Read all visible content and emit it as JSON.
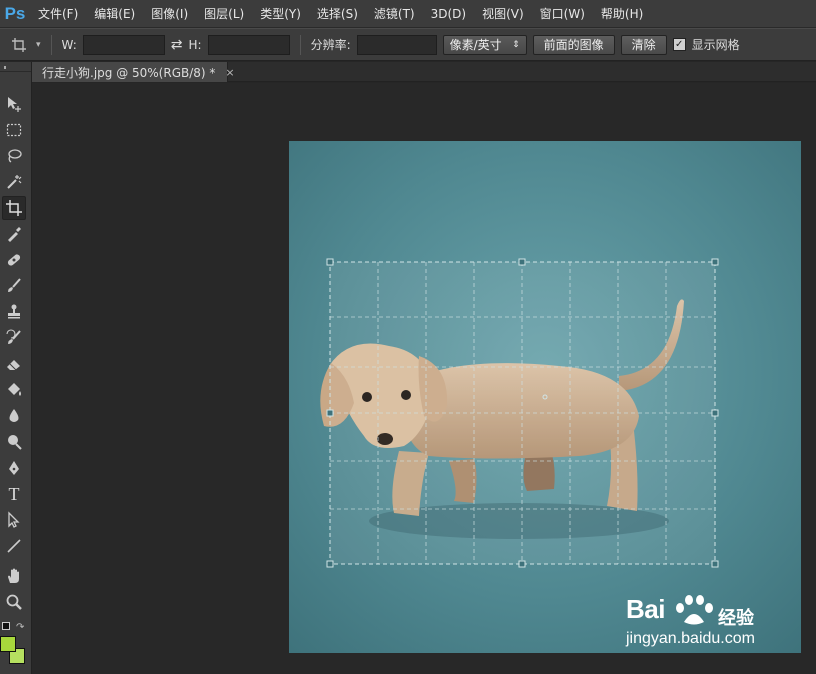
{
  "app": {
    "logo": "Ps"
  },
  "menu": [
    "文件(F)",
    "编辑(E)",
    "图像(I)",
    "图层(L)",
    "类型(Y)",
    "选择(S)",
    "滤镜(T)",
    "3D(D)",
    "视图(V)",
    "窗口(W)",
    "帮助(H)"
  ],
  "options": {
    "w_label": "W:",
    "w_value": "",
    "swap_symbol": "⇄",
    "h_label": "H:",
    "h_value": "",
    "resolution_label": "分辨率:",
    "resolution_value": "",
    "unit_select": "像素/英寸",
    "front_image_button": "前面的图像",
    "clear_button": "清除",
    "show_grid_label": "显示网格",
    "show_grid_checked": true
  },
  "document_tab": {
    "title": "行走小狗.jpg @ 50%(RGB/8) *",
    "close": "×"
  },
  "tools": [
    {
      "name": "move-tool",
      "icon": "move-icon",
      "active": false
    },
    {
      "name": "marquee-tool",
      "icon": "marquee-icon",
      "active": false
    },
    {
      "name": "lasso-tool",
      "icon": "lasso-icon",
      "active": false
    },
    {
      "name": "magic-wand-tool",
      "icon": "magic-wand-icon",
      "active": false
    },
    {
      "name": "crop-tool",
      "icon": "crop-icon",
      "active": true
    },
    {
      "name": "eyedropper-tool",
      "icon": "eyedropper-icon",
      "active": false
    },
    {
      "name": "healing-brush-tool",
      "icon": "bandage-icon",
      "active": false
    },
    {
      "name": "brush-tool",
      "icon": "brush-icon",
      "active": false
    },
    {
      "name": "clone-stamp-tool",
      "icon": "stamp-icon",
      "active": false
    },
    {
      "name": "history-brush-tool",
      "icon": "history-brush-icon",
      "active": false
    },
    {
      "name": "eraser-tool",
      "icon": "eraser-icon",
      "active": false
    },
    {
      "name": "paint-bucket-tool",
      "icon": "bucket-icon",
      "active": false
    },
    {
      "name": "blur-tool",
      "icon": "drop-icon",
      "active": false
    },
    {
      "name": "dodge-tool",
      "icon": "dodge-icon",
      "active": false
    },
    {
      "name": "pen-tool",
      "icon": "pen-icon",
      "active": false
    },
    {
      "name": "type-tool",
      "icon": "type-icon",
      "active": false
    },
    {
      "name": "path-selection-tool",
      "icon": "arrow-icon",
      "active": false
    },
    {
      "name": "line-tool",
      "icon": "line-icon",
      "active": false
    },
    {
      "name": "hand-tool",
      "icon": "hand-icon",
      "active": false
    },
    {
      "name": "zoom-tool",
      "icon": "zoom-icon",
      "active": false
    }
  ],
  "type_tool_glyph": "T",
  "colors": {
    "foreground": "#a8d83c",
    "background": "#b6e060",
    "canvas_bg": "#282828",
    "photo_bg": "#5a8e96",
    "accent": "#4aa8e8"
  },
  "watermark": {
    "brand": "Bai",
    "brand_cn": "经验",
    "url": "jingyan.baidu.com"
  }
}
